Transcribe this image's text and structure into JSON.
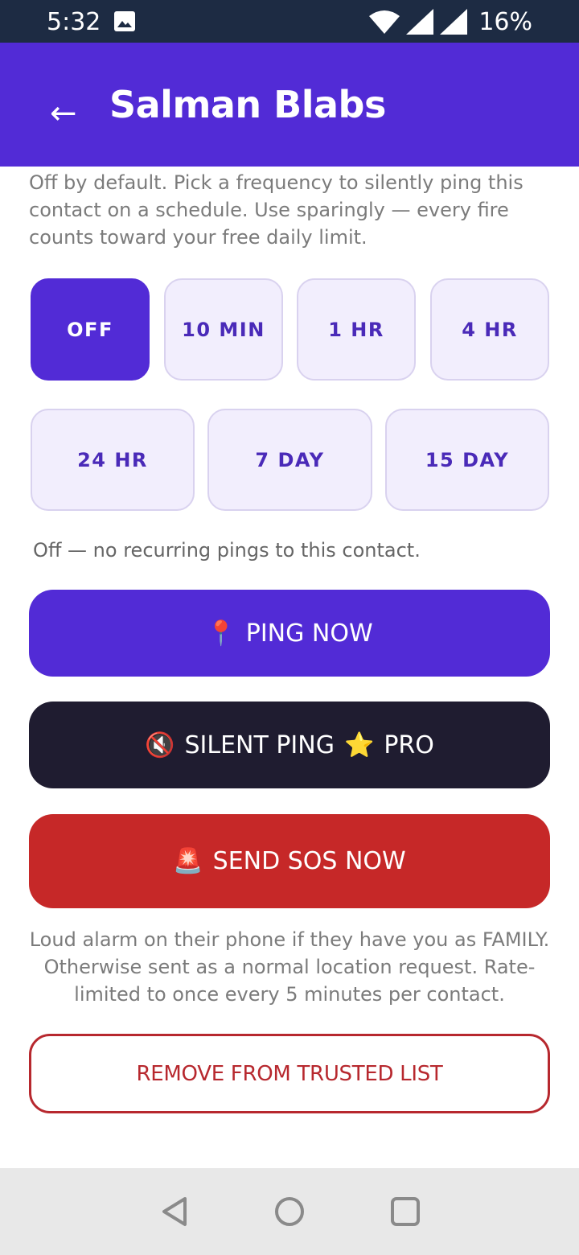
{
  "status_bar": {
    "time": "5:32",
    "battery": "16%",
    "icons": [
      "image-icon",
      "wifi-icon",
      "signal-icon",
      "signal-icon"
    ]
  },
  "app_bar": {
    "back_icon": "←",
    "title": "Salman Blabs"
  },
  "schedule": {
    "description": "Off by default. Pick a frequency to silently ping this contact on a schedule. Use sparingly — every fire counts toward your free daily limit.",
    "options": [
      "OFF",
      "10 MIN",
      "1 HR",
      "4 HR",
      "24 HR",
      "7 DAY",
      "15 DAY"
    ],
    "selected": "OFF",
    "status": "Off — no recurring pings to this contact."
  },
  "actions": {
    "ping_icon": "📍",
    "ping_label": "PING NOW",
    "silent_icon": "🔇",
    "silent_label": "SILENT PING",
    "silent_star": "⭐",
    "silent_badge": "PRO",
    "sos_icon": "🚨",
    "sos_label": "SEND SOS NOW",
    "sos_note": "Loud alarm on their phone if they have you as FAMILY. Otherwise sent as a normal location request. Rate-limited to once every 5 minutes per contact.",
    "remove_label": "REMOVE FROM TRUSTED LIST"
  },
  "colors": {
    "primary": "#522bd6",
    "dark": "#1f1c30",
    "danger": "#c62828",
    "status_bar": "#1d2b43"
  },
  "nav": {
    "icons": [
      "back-nav-icon",
      "home-nav-icon",
      "recents-nav-icon"
    ]
  }
}
